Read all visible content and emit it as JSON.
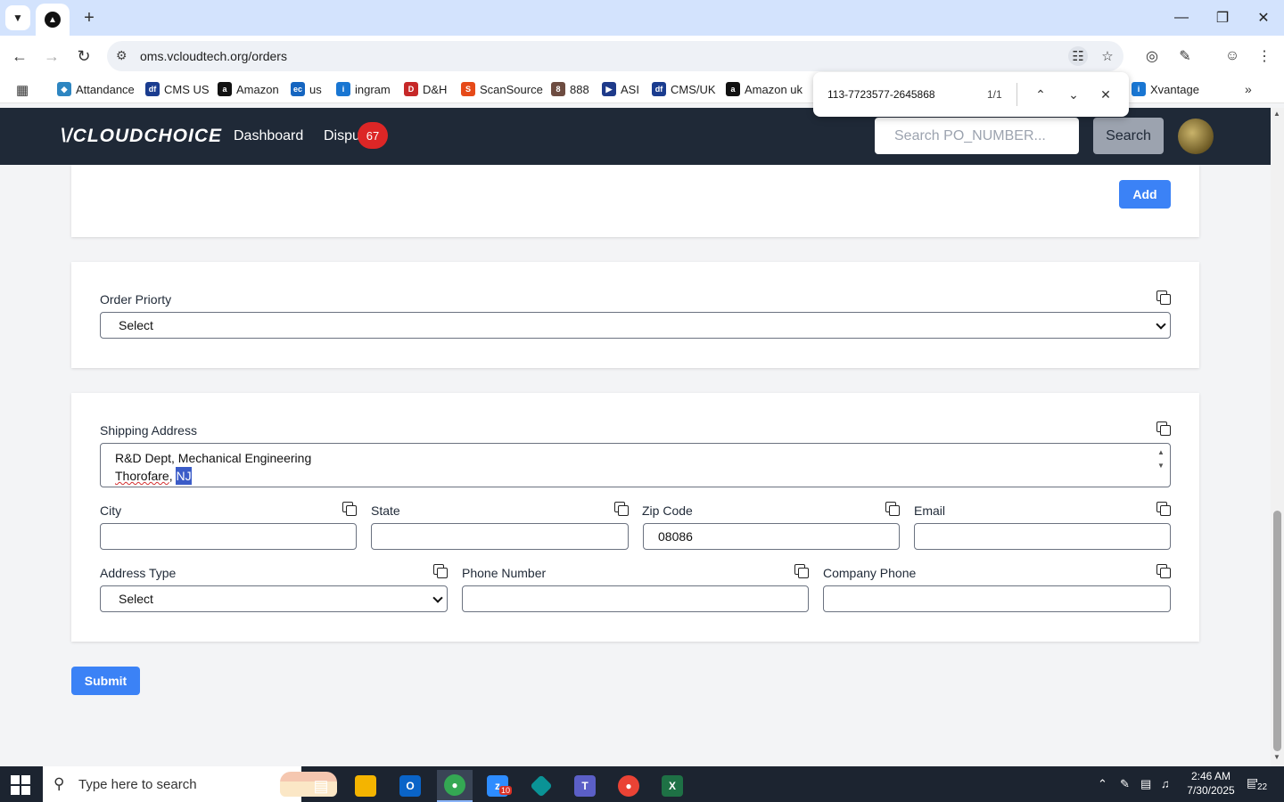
{
  "browser": {
    "tab_icon": "vercel-icon",
    "url": "oms.vcloudtech.org/orders",
    "bookmarks": [
      {
        "label": "Attandance",
        "icon": "diamond-icon",
        "color": "#2e86c1"
      },
      {
        "label": "CMS US",
        "icon": "df-icon",
        "color": "#1a3c8f"
      },
      {
        "label": "Amazon",
        "icon": "amazon-icon",
        "color": "#111111"
      },
      {
        "label": "us",
        "icon": "ec-icon",
        "color": "#1565c0"
      },
      {
        "label": "ingram",
        "icon": "ingram-icon",
        "color": "#1976d2"
      },
      {
        "label": "D&H",
        "icon": "dh-icon",
        "color": "#c62828"
      },
      {
        "label": "ScanSource",
        "icon": "scansource-icon",
        "color": "#e64a19"
      },
      {
        "label": "888",
        "icon": "888-icon",
        "color": "#6d4c41"
      },
      {
        "label": "ASI",
        "icon": "asi-icon",
        "color": "#1e3a8a"
      },
      {
        "label": "CMS/UK",
        "icon": "df-icon",
        "color": "#1a3c8f"
      },
      {
        "label": "Amazon uk",
        "icon": "amazon-icon",
        "color": "#111111"
      },
      {
        "label": "Xvantage",
        "icon": "ingram-icon",
        "color": "#1976d2"
      }
    ]
  },
  "findbar": {
    "query": "113-7723577-2645868",
    "count": "1/1"
  },
  "header": {
    "logo": "\\/CLOUDCHOICE",
    "nav": {
      "dashboard": "Dashboard",
      "disputes": "Dispu"
    },
    "disputes_badge": "67",
    "search_placeholder": "Search PO_NUMBER...",
    "search_button": "Search"
  },
  "form": {
    "add_button": "Add",
    "order_priority": {
      "label": "Order Priorty",
      "value": "Select"
    },
    "shipping": {
      "label": "Shipping Address",
      "line1": "R&D Dept, Mechanical Engineering",
      "line2_word": "Thorofare",
      "line2_comma": ", ",
      "line2_selected": "NJ"
    },
    "city": {
      "label": "City",
      "value": ""
    },
    "state": {
      "label": "State",
      "value": ""
    },
    "zip": {
      "label": "Zip Code",
      "value": "08086"
    },
    "email": {
      "label": "Email",
      "value": ""
    },
    "address_type": {
      "label": "Address Type",
      "value": "Select"
    },
    "phone": {
      "label": "Phone Number",
      "value": ""
    },
    "company_phone": {
      "label": "Company Phone",
      "value": ""
    },
    "submit_button": "Submit"
  },
  "colors": {
    "header_bg": "#1f2937",
    "primary_button": "#3b82f6",
    "badge": "#dc2626"
  },
  "taskbar": {
    "search_placeholder": "Type here to search",
    "time": "2:46 AM",
    "date": "7/30/2025",
    "notification_count": "22",
    "zoom_badge": "10"
  }
}
